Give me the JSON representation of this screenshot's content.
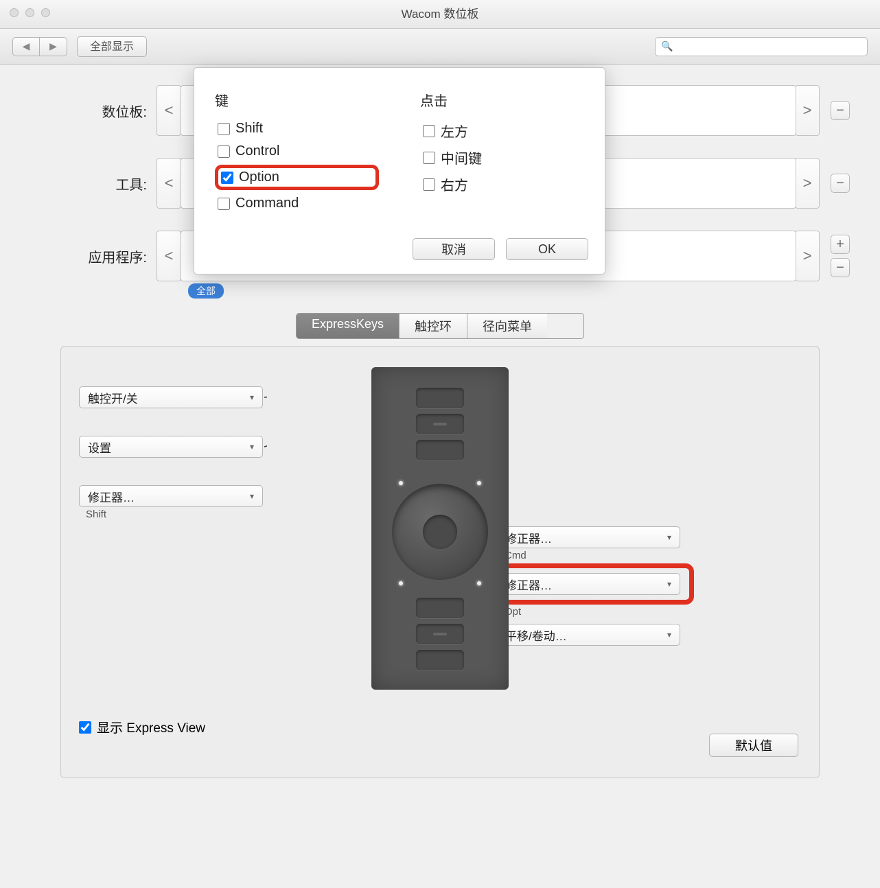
{
  "title": "Wacom 数位板",
  "toolbar": {
    "showAll": "全部显示"
  },
  "rows": {
    "tablet": "数位板:",
    "tool": "工具:",
    "app": "应用程序:",
    "appPill": "全部"
  },
  "modal": {
    "keysHeader": "键",
    "clickHeader": "点击",
    "keys": {
      "shift": "Shift",
      "control": "Control",
      "option": "Option",
      "command": "Command"
    },
    "clicks": {
      "left": "左方",
      "middle": "中间键",
      "right": "右方"
    },
    "cancel": "取消",
    "ok": "OK"
  },
  "tabs": {
    "express": "ExpressKeys",
    "ring": "触控环",
    "radial": "径向菜单"
  },
  "dd": {
    "touch": "触控开/关",
    "settings": "设置",
    "modifier": "修正器…",
    "shift": "Shift",
    "cmd": "Cmd",
    "opt": "Opt",
    "scroll": "平移/卷动…"
  },
  "showExpress": "显示 Express View",
  "defaultBtn": "默认值"
}
